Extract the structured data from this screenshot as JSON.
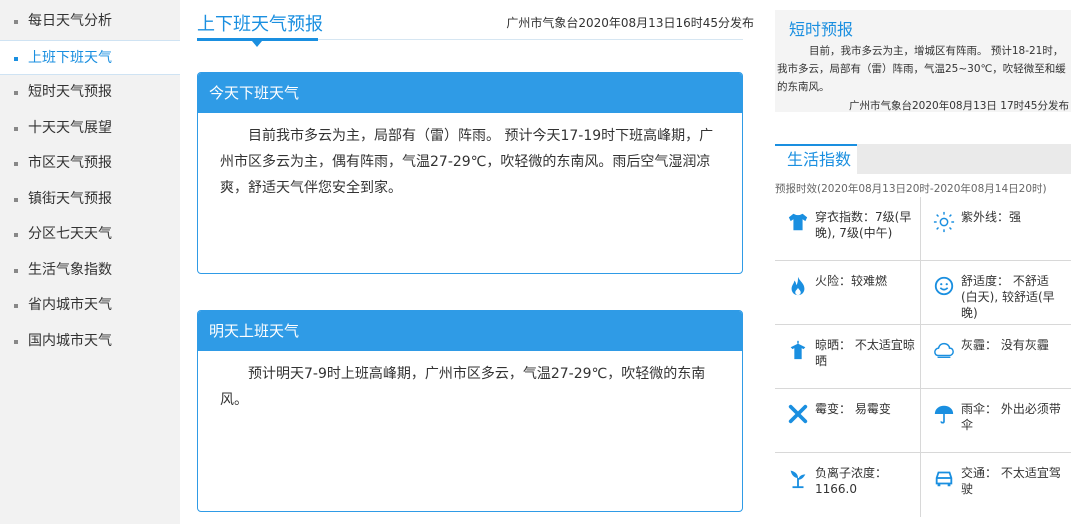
{
  "sidebar": {
    "items": [
      {
        "label": "每日天气分析"
      },
      {
        "label": "上班下班天气"
      },
      {
        "label": "短时天气预报"
      },
      {
        "label": "十天天气展望"
      },
      {
        "label": "市区天气预报"
      },
      {
        "label": "镇街天气预报"
      },
      {
        "label": "分区七天天气"
      },
      {
        "label": "生活气象指数"
      },
      {
        "label": "省内城市天气"
      },
      {
        "label": "国内城市天气"
      }
    ],
    "active_index": 1
  },
  "main": {
    "title": "上下班天气预报",
    "source": "广州市气象台2020年08月13日16时45分发布",
    "today": {
      "heading": "今天下班天气",
      "text": "目前我市多云为主，局部有（雷）阵雨。 预计今天17-19时下班高峰期，广州市区多云为主，偶有阵雨，气温27-29℃，吹轻微的东南风。雨后空气湿润凉爽，舒适天气伴您安全到家。"
    },
    "tomorrow": {
      "heading": "明天上班天气",
      "text": "预计明天7-9时上班高峰期，广州市区多云，气温27-29℃，吹轻微的东南风。"
    }
  },
  "short_forecast": {
    "title": "短时预报",
    "text": "目前，我市多云为主，增城区有阵雨。 预计18-21时，我市多云，局部有（雷）阵雨，气温25~30℃，吹轻微至和缓的东南风。",
    "source": "广州市气象台2020年08月13日 17时45分发布"
  },
  "life_index": {
    "tab": "生活指数",
    "period": "预报时效(2020年08月13日20时-2020年08月14日20时)",
    "items": [
      {
        "text": "穿衣指数：7级(早晚), 7级(中午)",
        "icon": "shirt-icon"
      },
      {
        "text": "紫外线：强",
        "icon": "sun-icon"
      },
      {
        "text": "火险：较难燃",
        "icon": "fire-icon"
      },
      {
        "text": "舒适度：  不舒适(白天), 较舒适(早晚)",
        "icon": "smile-icon"
      },
      {
        "text": "晾晒：  不太适宜晾晒",
        "icon": "hanger-icon"
      },
      {
        "text": "灰霾：  没有灰霾",
        "icon": "cloud-icon"
      },
      {
        "text": "霉变：  易霉变",
        "icon": "cross-icon"
      },
      {
        "text": "雨伞：  外出必须带伞",
        "icon": "umbrella-icon"
      },
      {
        "text": "负离子浓度：1166.0",
        "icon": "plant-icon"
      },
      {
        "text": "交通：  不太适宜驾驶",
        "icon": "car-icon"
      }
    ]
  },
  "colors": {
    "accent": "#1a8fe0",
    "card_header": "#2f9be6",
    "sidebar_bg": "#f2f2f2"
  }
}
